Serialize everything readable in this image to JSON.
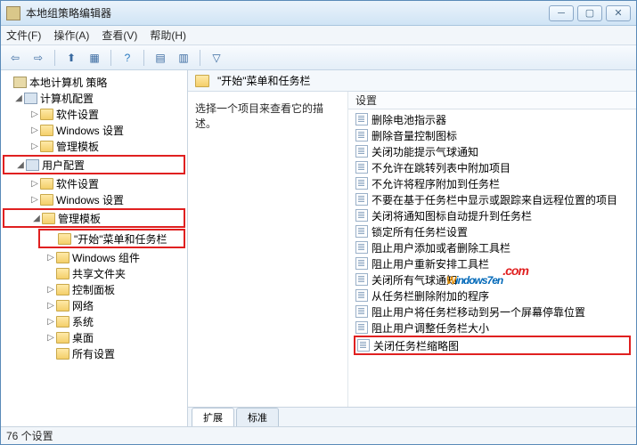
{
  "window": {
    "title": "本地组策略编辑器"
  },
  "menu": {
    "file": "文件(F)",
    "action": "操作(A)",
    "view": "查看(V)",
    "help": "帮助(H)"
  },
  "tree": {
    "root": "本地计算机 策略",
    "computer_cfg": "计算机配置",
    "cc_soft": "软件设置",
    "cc_win": "Windows 设置",
    "cc_tmpl": "管理模板",
    "user_cfg": "用户配置",
    "uc_soft": "软件设置",
    "uc_win": "Windows 设置",
    "uc_tmpl": "管理模板",
    "start_taskbar": "\"开始\"菜单和任务栏",
    "win_comp": "Windows 组件",
    "shared": "共享文件夹",
    "ctrl_panel": "控制面板",
    "network": "网络",
    "system": "系统",
    "desktop": "桌面",
    "all_settings": "所有设置"
  },
  "content": {
    "heading": "\"开始\"菜单和任务栏",
    "desc": "选择一个项目来查看它的描述。",
    "col_setting": "设置"
  },
  "settings": [
    "删除电池指示器",
    "删除音量控制图标",
    "关闭功能提示气球通知",
    "不允许在跳转列表中附加项目",
    "不允许将程序附加到任务栏",
    "不要在基于任务栏中显示或跟踪来自远程位置的项目",
    "关闭将通知图标自动提升到任务栏",
    "锁定所有任务栏设置",
    "阻止用户添加或者删除工具栏",
    "阻止用户重新安排工具栏",
    "关闭所有气球通知",
    "从任务栏删除附加的程序",
    "阻止用户将任务栏移动到另一个屏幕停靠位置",
    "阻止用户调整任务栏大小",
    "关闭任务栏缩略图"
  ],
  "highlight_index": 14,
  "tabs": {
    "extended": "扩展",
    "standard": "标准"
  },
  "status": "76 个设置",
  "watermark": {
    "w": "W",
    "rest": "indows7en",
    "suffix": ".com"
  }
}
